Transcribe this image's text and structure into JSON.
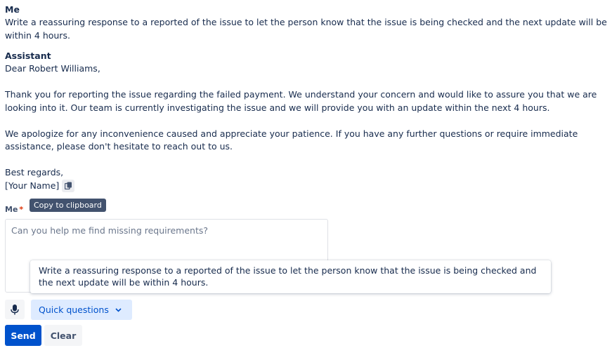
{
  "conversation": {
    "user_label": "Me",
    "user_message": "Write a reassuring response to a reported of the issue to let the person know that the issue is being checked and the next update will be within 4 hours.",
    "assistant_label": "Assistant",
    "assistant_greeting": "Dear Robert Williams,",
    "assistant_paragraph_1": "Thank you for reporting the issue regarding the failed payment. We understand your concern and would like to assure you that we are looking into it. Our team is currently investigating the issue and we will provide you with an update within the next 4 hours.",
    "assistant_paragraph_2": "We apologize for any inconvenience caused and appreciate your patience. If you have any further questions or require immediate assistance, please don't hesitate to reach out to us.",
    "assistant_closing": "Best regards,",
    "assistant_signature": "[Your Name]",
    "copy_tooltip": "Copy to clipboard",
    "copy_icon": "copy-icon"
  },
  "composer": {
    "label": "Me",
    "required_marker": "*",
    "placeholder": "Can you help me find missing requirements?",
    "suggestion": "Write a reassuring response to a reported of the issue to let the person know that the issue is being checked and the next update will be within 4 hours.",
    "mic_icon": "microphone-icon",
    "quick_questions_label": "Quick questions",
    "quick_questions_icon": "chevron-down-icon",
    "send_label": "Send",
    "clear_label": "Clear"
  },
  "colors": {
    "primary": "#0052cc",
    "primary_light": "#deebff",
    "text": "#172b4d",
    "tooltip_bg": "#42526e",
    "required": "#de350b"
  }
}
